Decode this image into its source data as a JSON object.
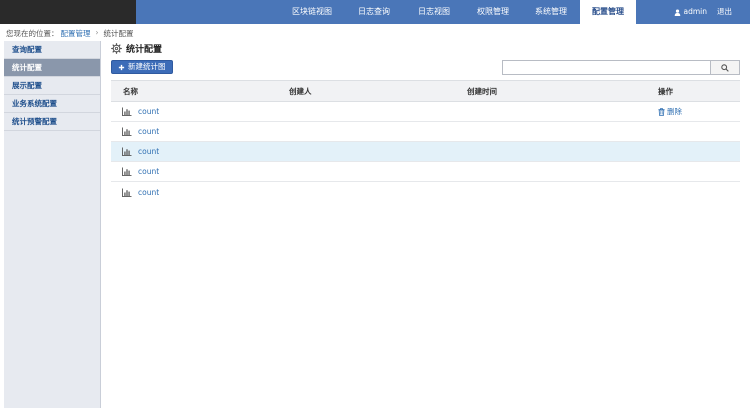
{
  "nav": {
    "items": [
      {
        "label": "区块链视图",
        "active": false
      },
      {
        "label": "日志查询",
        "active": false
      },
      {
        "label": "日志视图",
        "active": false
      },
      {
        "label": "权限管理",
        "active": false
      },
      {
        "label": "系统管理",
        "active": false
      },
      {
        "label": "配置管理",
        "active": true
      }
    ],
    "username": "admin",
    "logout": "退出"
  },
  "breadcrumb": {
    "prefix": "您现在的位置：",
    "parent": "配置管理",
    "separator": "›",
    "current": "统计配置"
  },
  "sidebar": {
    "items": [
      {
        "label": "查询配置",
        "active": false
      },
      {
        "label": "统计配置",
        "active": true
      },
      {
        "label": "展示配置",
        "active": false
      },
      {
        "label": "业务系统配置",
        "active": false
      },
      {
        "label": "统计预警配置",
        "active": false
      }
    ]
  },
  "main": {
    "title": "统计配置",
    "new_button": "新建统计图",
    "search_placeholder": "",
    "table": {
      "headers": {
        "name": "名称",
        "creator": "创建人",
        "time": "创建时间",
        "op": "操作"
      },
      "rows": [
        {
          "name": "count",
          "creator": "",
          "time": "",
          "op": "删除",
          "highlight": false
        },
        {
          "name": "count",
          "creator": "",
          "time": "",
          "op": "",
          "highlight": false
        },
        {
          "name": "count",
          "creator": "",
          "time": "",
          "op": "",
          "highlight": true
        },
        {
          "name": "count",
          "creator": "",
          "time": "",
          "op": "",
          "highlight": false
        },
        {
          "name": "count",
          "creator": "",
          "time": "",
          "op": "",
          "highlight": false
        }
      ]
    }
  },
  "icons": {
    "user": "user-icon",
    "gear": "gear-icon",
    "plus": "plus-icon",
    "search": "search-icon",
    "chart": "bar-chart-icon",
    "trash": "trash-icon"
  },
  "colors": {
    "topbar": "#4a76b8",
    "accent": "#2f6fb2",
    "sidebar_bg": "#e7eaf0",
    "sidebar_active": "#8a97ab",
    "row_highlight": "#e3f1f9"
  }
}
